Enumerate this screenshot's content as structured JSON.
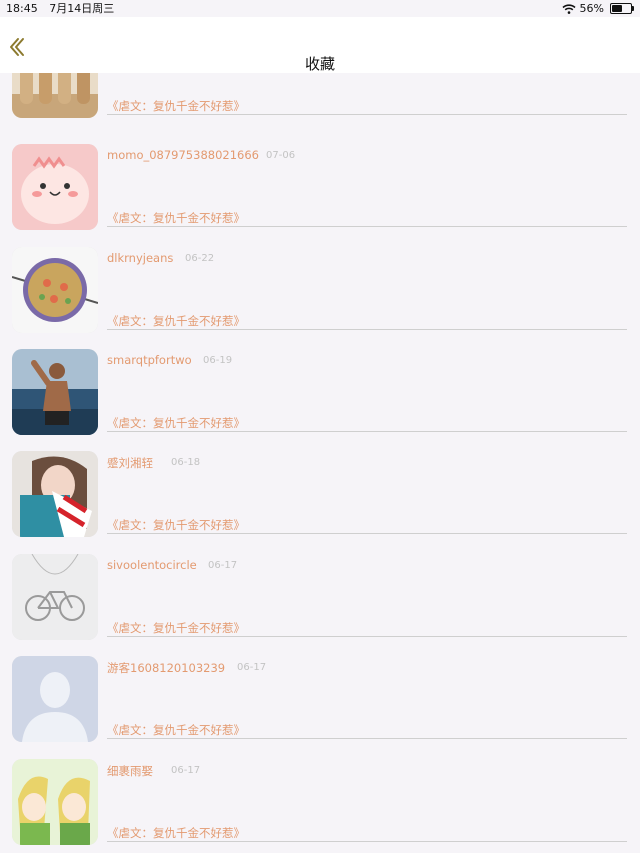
{
  "status_bar": {
    "time": "18:45",
    "date": "7月14日周三",
    "battery": "56%",
    "battery_level": 0.56,
    "wifi_icon": "wifi-icon"
  },
  "nav": {
    "back_icon": "chevron-left-icon",
    "title": "收藏"
  },
  "favorites": [
    {
      "username": "",
      "date": "",
      "title": "《虐文：复仇千金不好惹》",
      "avatar": "figurines-photo"
    },
    {
      "username": "momo_087975388021666",
      "date": "07-06",
      "title": "《虐文：复仇千金不好惹》",
      "avatar": "pink-dinosaur-cartoon"
    },
    {
      "username": "dlkrnyjeans",
      "date": "06-22",
      "title": "《虐文：复仇千金不好惹》",
      "avatar": "paella-pan-photo"
    },
    {
      "username": "smarqtpfortwo",
      "date": "06-19",
      "title": "《虐文：复仇千金不好惹》",
      "avatar": "man-at-sea-photo"
    },
    {
      "username": "蹙刘湘轾",
      "date": "06-18",
      "title": "《虐文：复仇千金不好惹》",
      "avatar": "girl-selfie-photo"
    },
    {
      "username": "sivoolentocircle",
      "date": "06-17",
      "title": "《虐文：复仇千金不好惹》",
      "avatar": "bicycle-necklace-photo"
    },
    {
      "username": "游客1608120103239",
      "date": "06-17",
      "title": "《虐文：复仇千金不好惹》",
      "avatar": "default-user-avatar"
    },
    {
      "username": "细裹雨娶",
      "date": "06-17",
      "title": "《虐文：复仇千金不好惹》",
      "avatar": "anime-elves-drawing"
    }
  ]
}
